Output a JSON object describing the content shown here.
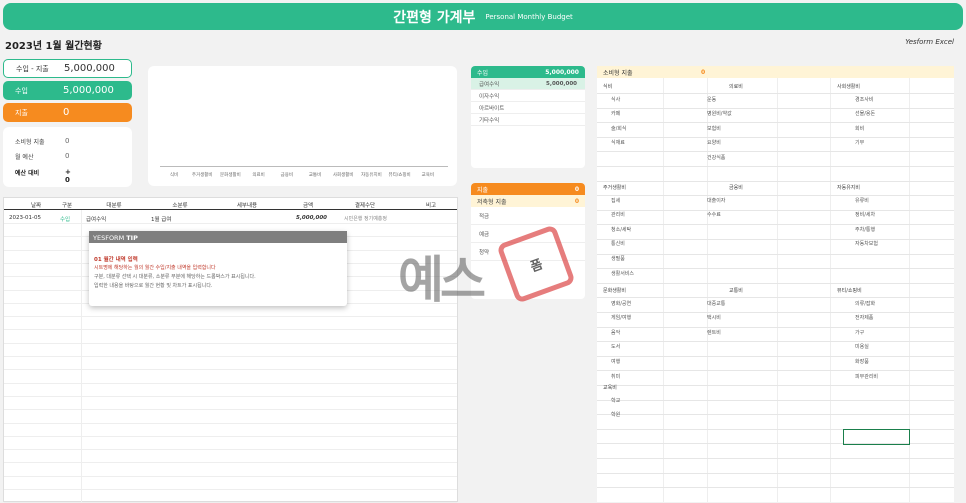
{
  "header": {
    "title": "간편형 가계부",
    "subtitle": "Personal Monthly Budget"
  },
  "page_title": "2023년 1월 월간현황",
  "brand": "Yesform Excel",
  "cards": {
    "income_expense": {
      "label": "수입 - 지출",
      "value": "5,000,000"
    },
    "income": {
      "label": "수입",
      "value": "5,000,000"
    },
    "expense": {
      "label": "지출",
      "value": "0"
    }
  },
  "stats": {
    "consumption": {
      "label": "소비형 지출",
      "value": "0"
    },
    "budget": {
      "label": "월 예산",
      "value": "0"
    },
    "vs_budget": {
      "label": "예산 대비",
      "value": "+ 0"
    }
  },
  "chart_data": {
    "type": "bar",
    "categories": [
      "식비",
      "주거생활비",
      "문화생활비",
      "의료비",
      "금융비",
      "교통비",
      "사회생활비",
      "자동유지비",
      "뷰티/쇼핑비",
      "교육비"
    ],
    "values": [
      0,
      0,
      0,
      0,
      0,
      0,
      0,
      0,
      0,
      0
    ]
  },
  "table": {
    "headers": [
      "날짜",
      "구분",
      "대분류",
      "소분류",
      "세부내용",
      "금액",
      "결제수단",
      "비고"
    ],
    "rows": [
      {
        "date": "2023-01-05",
        "type": "수입",
        "major": "급여수익",
        "minor": "1월 급여",
        "detail": "",
        "amount": "5,000,000",
        "pay": "시민은행 정기예총정",
        "note": ""
      }
    ]
  },
  "tip": {
    "head_a": "YESFORM ",
    "head_b": "TIP",
    "title": "01 월간 내역 입력",
    "line1": "시트명에 해당하는 월의 월간 수입/지출 내역을 입력합니다",
    "line2": "구분, 대분류 선택 시 대분류, 소분류 부분에 해당하는 드롭박스가 표시됩니다.",
    "line3": "입력한 내용을 바탕으로 월간 현황 및 차트가 표시됩니다."
  },
  "income_panel": {
    "head_label": "수입",
    "head_value": "5,000,000",
    "rows": [
      {
        "label": "급여수익",
        "value": "5,000,000"
      },
      {
        "label": "이자수익",
        "value": ""
      },
      {
        "label": "아르바이트",
        "value": ""
      },
      {
        "label": "기타수익",
        "value": ""
      }
    ]
  },
  "expense_panel": {
    "head_label": "지출",
    "head_value": "0",
    "sub_label": "저축형 지출",
    "sub_value": "0",
    "rows": [
      "적금",
      "예금",
      "청약"
    ]
  },
  "consumption_panel": {
    "head_label": "소비형 지출",
    "head_value": "0",
    "sections": [
      {
        "title": "식비",
        "items": [
          "식사",
          "카페",
          "술/회식",
          "식재료"
        ]
      },
      {
        "title": "의료비",
        "items": [
          "운동",
          "병원비/약값",
          "보험비",
          "요양비",
          "건강식품"
        ]
      },
      {
        "title": "사회생활비",
        "items": [
          "경조사비",
          "선물/용돈",
          "회비",
          "기부"
        ]
      },
      {
        "title": "주거생활비",
        "items": [
          "집세",
          "관리비",
          "청소/세탁",
          "통신비",
          "생필품",
          "생활서비스"
        ]
      },
      {
        "title": "금융비",
        "items": [
          "대출이자",
          "수수료"
        ]
      },
      {
        "title": "자동유지비",
        "items": [
          "유류비",
          "정비/세차",
          "주차/통행",
          "자동차보험"
        ]
      },
      {
        "title": "문화생활비",
        "items": [
          "영화/공연",
          "게임/여행",
          "음악",
          "도서",
          "여행",
          "취미"
        ]
      },
      {
        "title": "교통비",
        "items": [
          "대중교통",
          "택시비",
          "렌트비"
        ]
      },
      {
        "title": "뷰티/쇼핑비",
        "items": [
          "의류/잡화",
          "전자제품",
          "가구",
          "미용실",
          "화장품",
          "피부관리비"
        ]
      },
      {
        "title": "교육비",
        "items": [
          "학교",
          "학원"
        ]
      }
    ]
  },
  "watermark": {
    "text": "예스",
    "stamp": "폼"
  },
  "colors": {
    "green": "#2dba8c",
    "orange": "#f68b1f",
    "light_green": "#d9f2e6",
    "light_yellow": "#fff4d6"
  }
}
